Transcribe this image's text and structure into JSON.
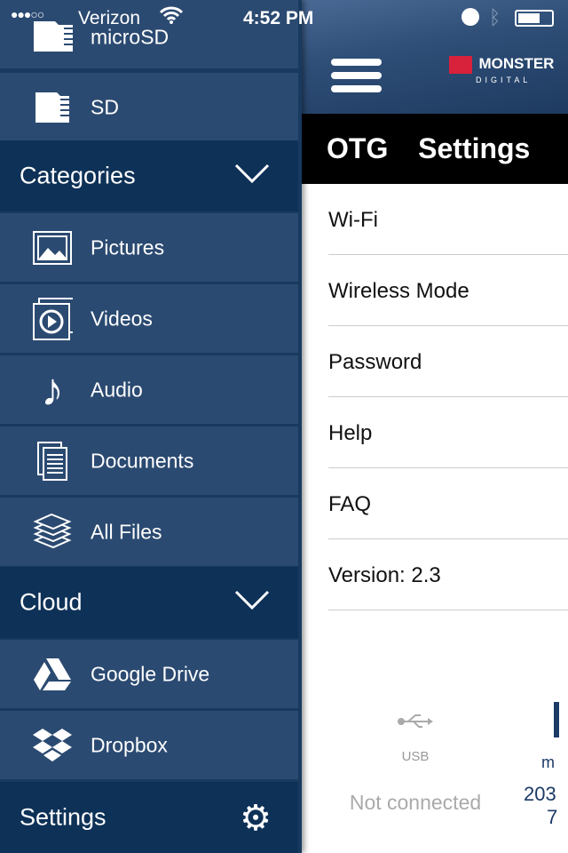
{
  "status_bar": {
    "carrier": "Verizon",
    "time": "4:52 PM"
  },
  "sidebar": {
    "storage": [
      {
        "label": "microSD",
        "icon": "microsd-card-icon"
      },
      {
        "label": "SD",
        "icon": "sd-card-icon"
      }
    ],
    "categories_label": "Categories",
    "categories": [
      {
        "label": "Pictures",
        "icon": "picture-icon"
      },
      {
        "label": "Videos",
        "icon": "video-icon"
      },
      {
        "label": "Audio",
        "icon": "music-note-icon"
      },
      {
        "label": "Documents",
        "icon": "document-icon"
      },
      {
        "label": "All Files",
        "icon": "files-stack-icon"
      }
    ],
    "cloud_label": "Cloud",
    "cloud": [
      {
        "label": "Google Drive",
        "icon": "google-drive-icon"
      },
      {
        "label": "Dropbox",
        "icon": "dropbox-icon"
      }
    ],
    "settings_label": "Settings"
  },
  "main": {
    "logo_text": "MONSTER",
    "logo_sub": "DIGITAL",
    "title": "OTG  Settings",
    "rows": [
      "Wi-Fi",
      "Wireless Mode",
      "Password",
      "Help",
      "FAQ",
      "Version: 2.3"
    ],
    "usb": {
      "label": "USB",
      "status": "Not connected"
    },
    "device": {
      "label": "m",
      "line1": "203",
      "line2": "7"
    }
  },
  "colors": {
    "sidebar_item": "#2b4a71",
    "sidebar_section": "#0e3157",
    "logo_red": "#d8213a"
  }
}
